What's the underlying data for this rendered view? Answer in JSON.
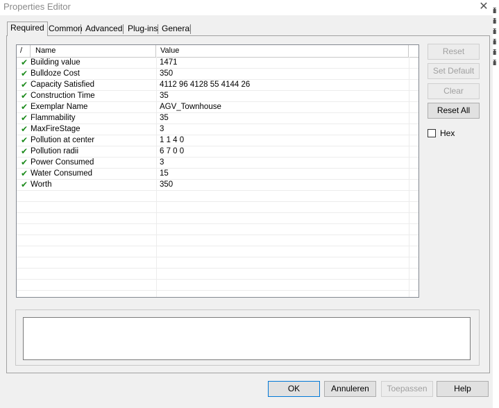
{
  "window": {
    "title": "Properties Editor",
    "close_icon": "close-icon"
  },
  "tabs": [
    "Required",
    "Common",
    "Advanced",
    "Plug-ins",
    "General"
  ],
  "active_tab": "Required",
  "table": {
    "columns": {
      "sort": "/",
      "name": "Name",
      "value": "Value"
    },
    "rows": [
      {
        "name": "Building value",
        "value": "1471"
      },
      {
        "name": "Bulldoze Cost",
        "value": "350"
      },
      {
        "name": "Capacity Satisfied",
        "value": "4112 96 4128 55 4144 26"
      },
      {
        "name": "Construction Time",
        "value": "35"
      },
      {
        "name": "Exemplar Name",
        "value": "AGV_Townhouse"
      },
      {
        "name": "Flammability",
        "value": "35"
      },
      {
        "name": "MaxFireStage",
        "value": "3"
      },
      {
        "name": "Pollution at center",
        "value": "1 1 4 0"
      },
      {
        "name": "Pollution radii",
        "value": "6 7 0 0"
      },
      {
        "name": "Power Consumed",
        "value": "3"
      },
      {
        "name": "Water Consumed",
        "value": "15"
      },
      {
        "name": "Worth",
        "value": "350"
      }
    ],
    "check_glyph": "✔"
  },
  "side_buttons": {
    "reset": "Reset",
    "set_default": "Set Default",
    "clear": "Clear",
    "reset_all": "Reset All"
  },
  "hex": {
    "label": "Hex",
    "checked": false
  },
  "bottom_buttons": {
    "ok": "OK",
    "cancel": "Annuleren",
    "apply": "Toepassen",
    "help": "Help"
  },
  "background_window_fragments": [
    "ili",
    "ili",
    "ili",
    "ili",
    "ili",
    "ili"
  ]
}
